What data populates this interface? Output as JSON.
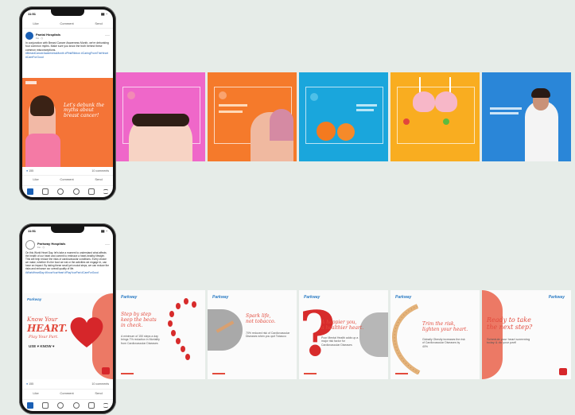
{
  "post1": {
    "status_time": "11:51",
    "top_actions": [
      "Like",
      "Comment",
      "Send"
    ],
    "poster_name": "Pantai Hospitals",
    "poster_meta": "1w · ◷",
    "caption_text": "In conjunction with Breast Cancer Awareness Month, we're debunking four common myths. Make sure you know the truth behind these common misconceptions.",
    "caption_tags": "#BreastCancerAwarenessMonth #PinkRibbon #CaringFromTheHeart #CareForGood",
    "hero_text": "Let's debunk the myths about breast cancer!",
    "reactions": "155",
    "comments": "10 comments",
    "bottom_actions": [
      "Like",
      "Comment",
      "Send"
    ]
  },
  "post2": {
    "status_time": "11:51",
    "poster_name": "Parkway Hospitals",
    "poster_meta": "1w · ◷",
    "caption_text": "On this World Heart Day, let's take a moment to understand what affects the health of our heart and commit to embrace a heart-healthy lifestyle. This will help reduce the risks of cardiovascular conditions. Every choice we make, whether it's the food we eat or the activities we engage in, can have an impact. By taking these small yet crucial steps, we can reduce the risks and enhance our overall quality of life.",
    "caption_tags": "#WorldHeartDay #KnowYourHeart #PlayYourPart #CareForGood",
    "brand": "Parkway",
    "hero_l1": "Know Your",
    "hero_l2": "HEART.",
    "hero_l3": "Play Your Part.",
    "hero_l4": "USE ♥ KNOW ♥",
    "reactions": "155",
    "comments": "10 comments",
    "bottom_actions": [
      "Like",
      "Comment",
      "Send"
    ]
  },
  "row1_slides": [
    {
      "color": "#ef67c9"
    },
    {
      "color": "#f57a2b"
    },
    {
      "color": "#1aa6dc"
    },
    {
      "color": "#f9ad20"
    },
    {
      "color": "#2a86d8"
    }
  ],
  "row2_slides": [
    {
      "title_l1": "Step by step",
      "title_l2": "keep the beats",
      "title_l3": "in check.",
      "sub": "A minimum of 150 steps a day brings 7% reduction in Mortality from Cardiovascular Diseases"
    },
    {
      "title_l1": "Spark life,",
      "title_l2": "not tobacco.",
      "sub": "70% reduced risk of Cardiovascular Diseases when you quit Tobacco"
    },
    {
      "title_l1": "A happier you,",
      "title_l2": "a healthier heart.",
      "sub": "Poor Mental Health adds up a major risk factor for Cardiovascular Diseases"
    },
    {
      "title_l1": "Trim the risk,",
      "title_l2": "lighten your heart.",
      "sub": "Globally Obesity increases the risk of Cardiovascular Diseases by 40%"
    },
    {
      "title_l1": "Ready to take",
      "title_l2": "the next step?",
      "sub": "Schedule your heart screening today & do your part!"
    }
  ],
  "colors": {
    "accent_red": "#e24a3c",
    "link_blue": "#1a5fb4"
  }
}
